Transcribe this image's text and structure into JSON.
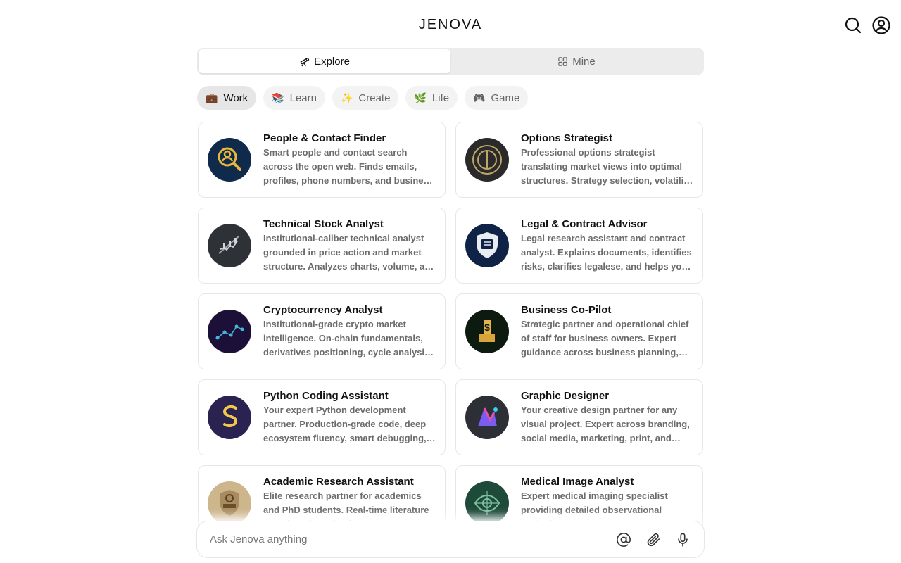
{
  "brand": "JENOVA",
  "header": {
    "search_icon": "search-icon",
    "account_icon": "user-circle-icon"
  },
  "segmented": {
    "explore_label": "Explore",
    "mine_label": "Mine",
    "active": "explore"
  },
  "categories": [
    {
      "emoji": "💼",
      "label": "Work",
      "active": true
    },
    {
      "emoji": "📚",
      "label": "Learn",
      "active": false
    },
    {
      "emoji": "✨",
      "label": "Create",
      "active": false
    },
    {
      "emoji": "🌿",
      "label": "Life",
      "active": false
    },
    {
      "emoji": "🎮",
      "label": "Game",
      "active": false
    }
  ],
  "cards": [
    {
      "title": "People & Contact Finder",
      "desc": "Smart people and contact search across the open web. Finds emails, profiles, phone numbers, and business contact details.",
      "avatar_color": "#0f2a4a",
      "icon": "magnifier-person-icon"
    },
    {
      "title": "Options Strategist",
      "desc": "Professional options strategist translating market views into optimal structures. Strategy selection, volatility analysis.",
      "avatar_color": "#2a2a2a",
      "icon": "concentric-circle-icon"
    },
    {
      "title": "Technical Stock Analyst",
      "desc": "Institutional-caliber technical analyst grounded in price action and market structure. Analyzes charts, volume, and momentum.",
      "avatar_color": "#2e3236",
      "icon": "candlestick-chart-icon"
    },
    {
      "title": "Legal & Contract Advisor",
      "desc": "Legal research assistant and contract analyst. Explains documents, identifies risks, clarifies legalese, and helps you negotiate.",
      "avatar_color": "#0f2347",
      "icon": "legal-shield-icon"
    },
    {
      "title": "Cryptocurrency Analyst",
      "desc": "Institutional-grade crypto market intelligence. On-chain fundamentals, derivatives positioning, cycle analysis and more.",
      "avatar_color": "#1c1038",
      "icon": "network-nodes-icon"
    },
    {
      "title": "Business Co-Pilot",
      "desc": "Strategic partner and operational chief of staff for business owners. Expert guidance across business planning, operations.",
      "avatar_color": "#0c1a10",
      "icon": "dollar-building-icon"
    },
    {
      "title": "Python Coding Assistant",
      "desc": "Your expert Python development partner. Production-grade code, deep ecosystem fluency, smart debugging, and testing.",
      "avatar_color": "#2a2250",
      "icon": "python-snake-icon"
    },
    {
      "title": "Graphic Designer",
      "desc": "Your creative design partner for any visual project. Expert across branding, social media, marketing, print, and more.",
      "avatar_color": "#2c2f36",
      "icon": "design-shape-icon"
    },
    {
      "title": "Academic Research Assistant",
      "desc": "Elite research partner for academics and PhD students. Real-time literature search and synthesis.",
      "avatar_color": "#cdb58c",
      "icon": "academic-shield-icon"
    },
    {
      "title": "Medical Image Analyst",
      "desc": "Expert medical imaging specialist providing detailed observational analysis.",
      "avatar_color": "#1e4a3a",
      "icon": "scan-eye-icon"
    }
  ],
  "composer": {
    "placeholder": "Ask Jenova anything",
    "mention_icon": "at-sign-icon",
    "attach_icon": "paperclip-icon",
    "mic_icon": "microphone-icon"
  }
}
